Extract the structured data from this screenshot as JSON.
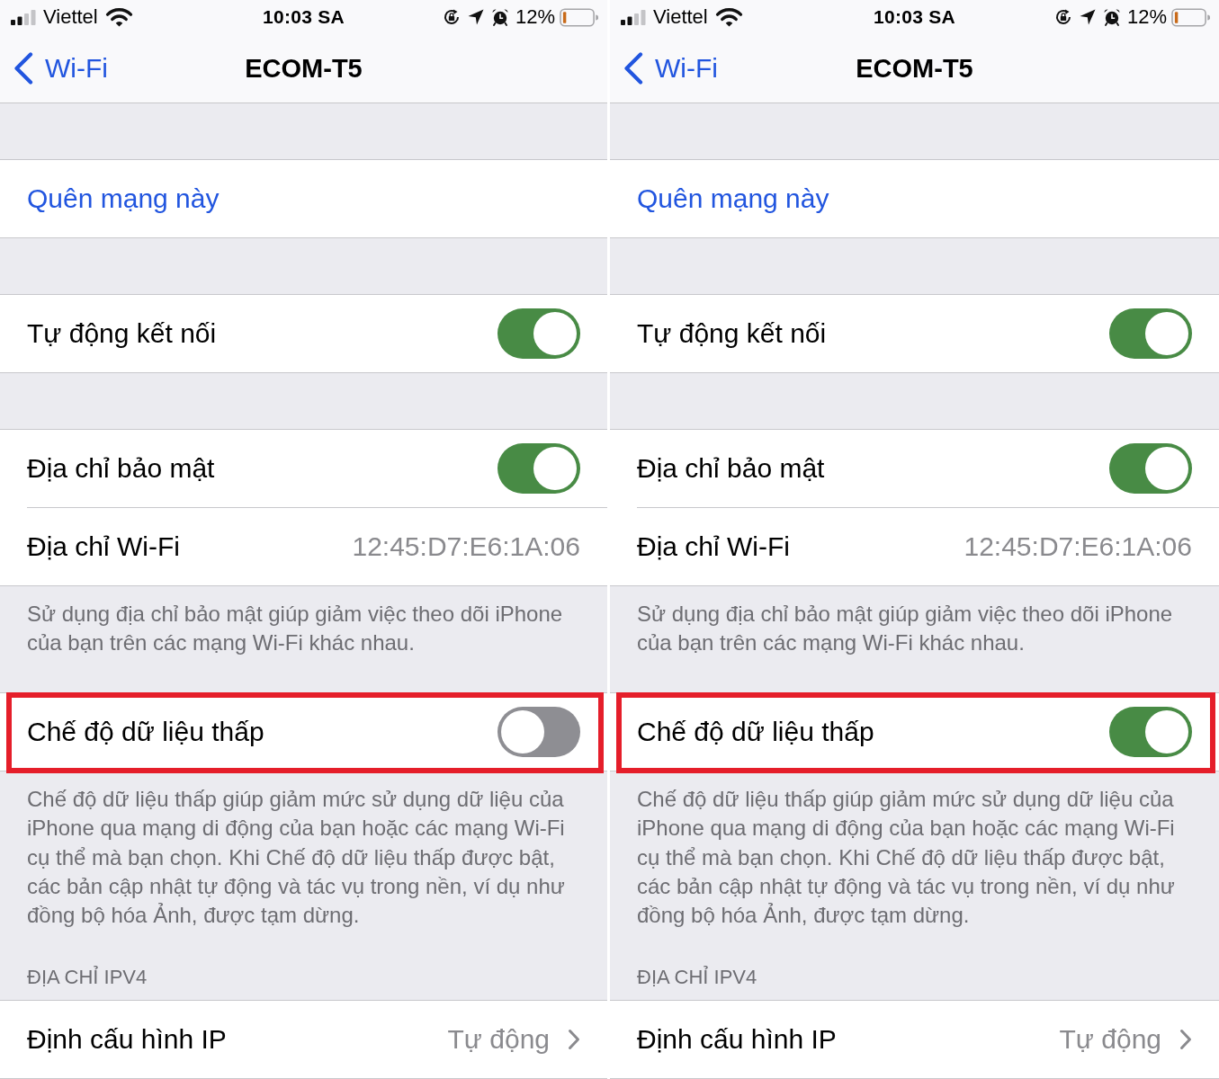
{
  "panels": [
    {
      "status_bar": {
        "carrier": "Viettel",
        "time": "10:03 SA",
        "battery_percent": "12%"
      },
      "nav_bar": {
        "back_label": "Wi-Fi",
        "title": "ECOM-T5"
      },
      "sections": [
        {
          "rows": [
            {
              "kind": "action",
              "label": "Quên mạng này",
              "highlighted": false
            }
          ]
        },
        {
          "rows": [
            {
              "kind": "toggle",
              "label": "Tự động kết nối",
              "on": true,
              "highlighted": false
            }
          ]
        },
        {
          "rows": [
            {
              "kind": "toggle",
              "label": "Địa chỉ bảo mật",
              "on": true,
              "highlighted": false
            },
            {
              "kind": "value",
              "label": "Địa chỉ Wi-Fi",
              "value": "12:45:D7:E6:1A:06",
              "highlighted": false
            }
          ],
          "footer": "Sử dụng địa chỉ bảo mật giúp giảm việc theo dõi iPhone của bạn trên các mạng Wi-Fi khác nhau."
        },
        {
          "rows": [
            {
              "kind": "toggle",
              "label": "Chế độ dữ liệu thấp",
              "on": false,
              "highlighted": true
            }
          ],
          "footer": "Chế độ dữ liệu thấp giúp giảm mức sử dụng dữ liệu của iPhone qua mạng di động của bạn hoặc các mạng Wi-Fi cụ thể mà bạn chọn. Khi Chế độ dữ liệu thấp được bật, các bản cập nhật tự động và tác vụ trong nền, ví dụ như đồng bộ hóa Ảnh, được tạm dừng."
        },
        {
          "header": "ĐỊA CHỈ IPV4",
          "rows": [
            {
              "kind": "link",
              "label": "Định cấu hình IP",
              "value": "Tự động",
              "highlighted": false
            }
          ]
        }
      ]
    },
    {
      "status_bar": {
        "carrier": "Viettel",
        "time": "10:03 SA",
        "battery_percent": "12%"
      },
      "nav_bar": {
        "back_label": "Wi-Fi",
        "title": "ECOM-T5"
      },
      "sections": [
        {
          "rows": [
            {
              "kind": "action",
              "label": "Quên mạng này",
              "highlighted": false
            }
          ]
        },
        {
          "rows": [
            {
              "kind": "toggle",
              "label": "Tự động kết nối",
              "on": true,
              "highlighted": false
            }
          ]
        },
        {
          "rows": [
            {
              "kind": "toggle",
              "label": "Địa chỉ bảo mật",
              "on": true,
              "highlighted": false
            },
            {
              "kind": "value",
              "label": "Địa chỉ Wi-Fi",
              "value": "12:45:D7:E6:1A:06",
              "highlighted": false
            }
          ],
          "footer": "Sử dụng địa chỉ bảo mật giúp giảm việc theo dõi iPhone của bạn trên các mạng Wi-Fi khác nhau."
        },
        {
          "rows": [
            {
              "kind": "toggle",
              "label": "Chế độ dữ liệu thấp",
              "on": true,
              "highlighted": true
            }
          ],
          "footer": "Chế độ dữ liệu thấp giúp giảm mức sử dụng dữ liệu của iPhone qua mạng di động của bạn hoặc các mạng Wi-Fi cụ thể mà bạn chọn. Khi Chế độ dữ liệu thấp được bật, các bản cập nhật tự động và tác vụ trong nền, ví dụ như đồng bộ hóa Ảnh, được tạm dừng."
        },
        {
          "header": "ĐỊA CHỈ IPV4",
          "rows": [
            {
              "kind": "link",
              "label": "Định cấu hình IP",
              "value": "Tự động",
              "highlighted": false
            }
          ]
        }
      ]
    }
  ]
}
